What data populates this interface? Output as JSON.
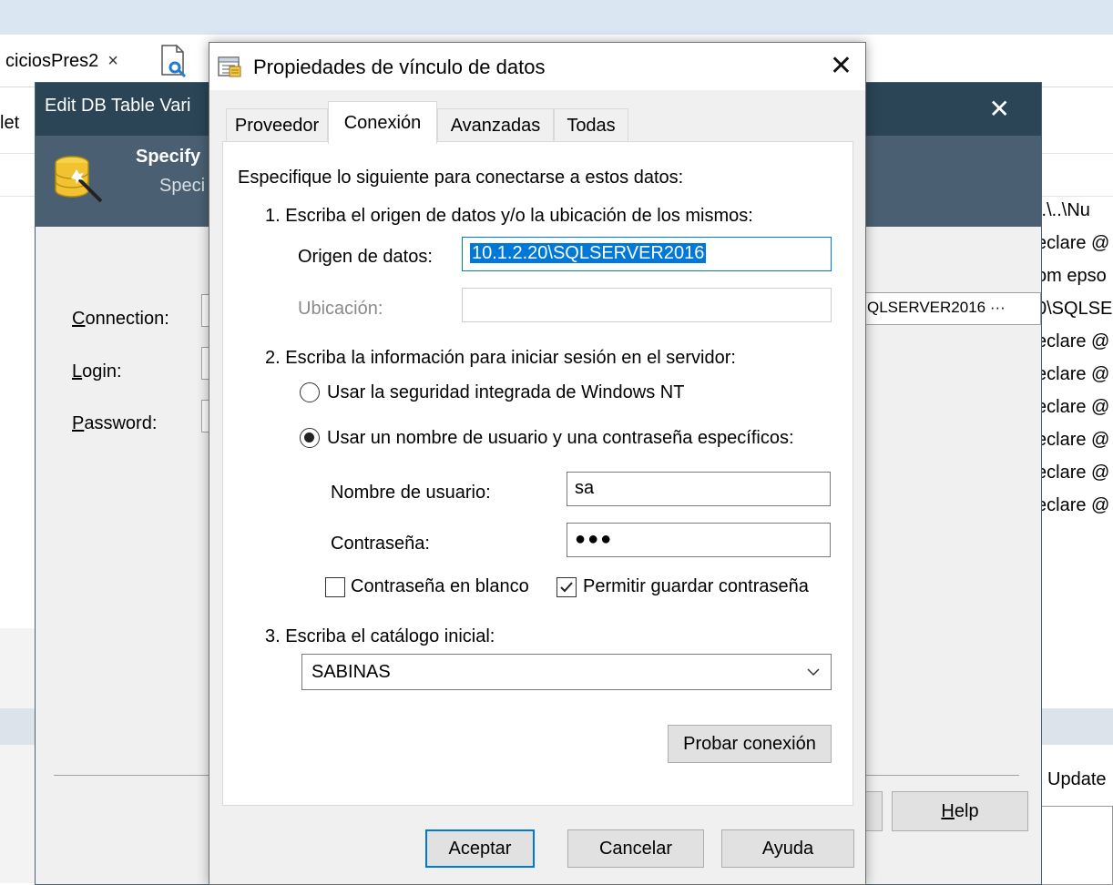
{
  "background": {
    "tab": {
      "label": "ciciosPres2",
      "close": "×"
    },
    "right_cells": [
      "..\\..\\Nu",
      "eclare @",
      "om epso",
      "0\\SQLSE",
      "eclare @",
      "eclare @",
      "eclare @",
      "eclare @",
      "eclare @",
      "eclare @"
    ],
    "left_fragment": "let",
    "update_label": "Update"
  },
  "edit_window": {
    "title": "Edit DB Table Vari",
    "close": "✕",
    "banner_title": "Specify",
    "banner_subtitle": "Speci",
    "fields": [
      {
        "label_hotkey": "C",
        "label_rest": "onnection:"
      },
      {
        "label_hotkey": "L",
        "label_rest": "ogin:"
      },
      {
        "label_hotkey": "P",
        "label_rest": "assword:"
      }
    ],
    "connection_value": "QLSERVER2016 ···",
    "help_hotkey": "H",
    "help_rest": "elp"
  },
  "dialog": {
    "title": "Propiedades de vínculo de datos",
    "close": "✕",
    "tabs": [
      "Proveedor",
      "Conexión",
      "Avanzadas",
      "Todas"
    ],
    "active_tab": "Conexión",
    "intro": "Especifique lo siguiente para conectarse a estos datos:",
    "step1": {
      "heading": "1. Escriba el origen de datos y/o la ubicación de los mismos:",
      "source_label": "Origen de datos:",
      "source_value": "10.1.2.20\\SQLSERVER2016",
      "location_label": "Ubicación:",
      "location_value": ""
    },
    "step2": {
      "heading": "2. Escriba la información para iniciar sesión en el servidor:",
      "radio_integrated": "Usar la seguridad integrada de Windows NT",
      "radio_specific": "Usar un nombre de usuario y una contraseña específicos:",
      "selected": "specific",
      "username_label": "Nombre de usuario:",
      "username_value": "sa",
      "password_label": "Contraseña:",
      "password_value": "●●●",
      "blank_password_label": "Contraseña en blanco",
      "blank_password_checked": false,
      "save_password_label": "Permitir guardar contraseña",
      "save_password_checked": true
    },
    "step3": {
      "heading": "3. Escriba el catálogo inicial:",
      "catalog_value": "SABINAS"
    },
    "test_button": "Probar conexión",
    "buttons": {
      "ok": "Aceptar",
      "cancel": "Cancelar",
      "help": "Ayuda"
    }
  },
  "colors": {
    "accent": "#0078d7",
    "edit_titlebar": "#2b4456",
    "edit_banner": "#4a6072"
  }
}
